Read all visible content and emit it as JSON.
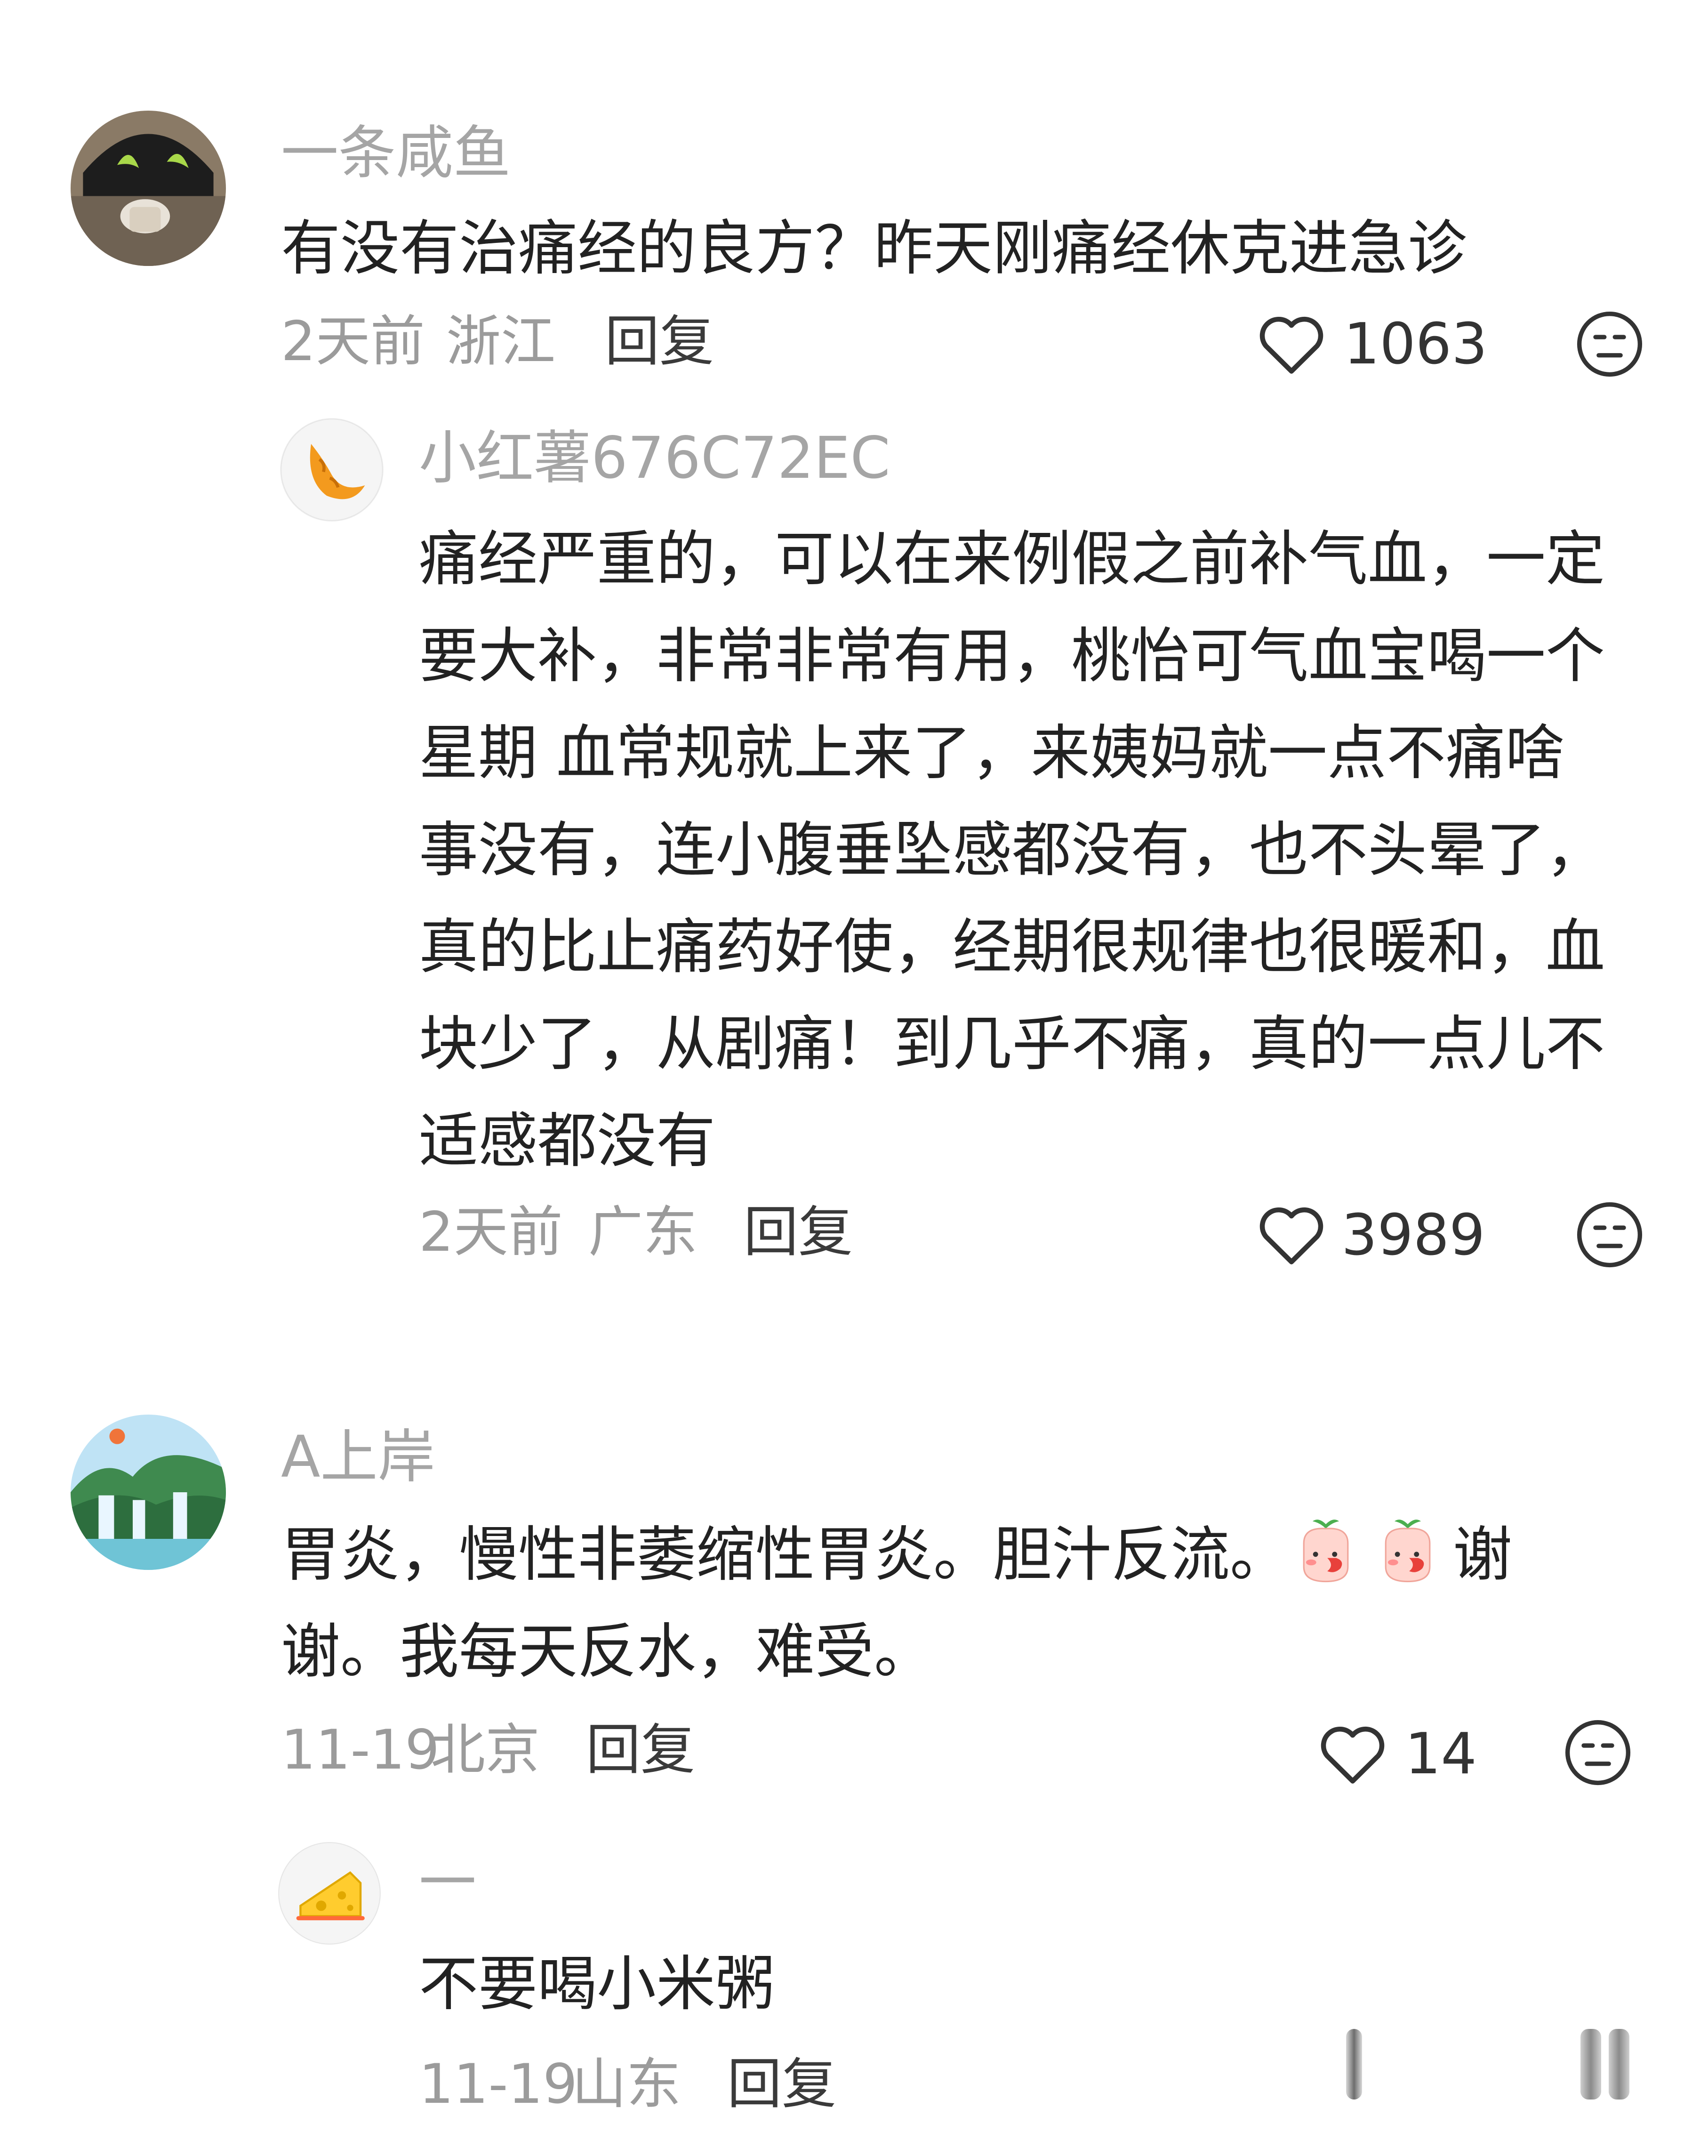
{
  "comments": [
    {
      "username": "一条咸鱼",
      "text": "有没有治痛经的良方？昨天刚痛经休克进急诊",
      "time": "2天前",
      "location": "浙江",
      "reply_label": "回复",
      "likes": "1063",
      "reply": {
        "username": "小红薯676C72EC",
        "text": "痛经严重的，可以在来例假之前补气血，一定要大补，非常非常有用，桃怡可气血宝喝一个星期 血常规就上来了，来姨妈就一点不痛啥事没有，连小腹垂坠感都没有，也不头晕了，真的比止痛药好使，经期很规律也很暖和，血块少了，从剧痛！到几乎不痛，真的一点儿不适感都没有",
        "time": "2天前",
        "location": "广东",
        "reply_label": "回复",
        "likes": "3989"
      }
    },
    {
      "username": "A上岸",
      "text_before_emoji": "胃炎，慢性非萎缩性胃炎。胆汁反流。",
      "text_after_emoji": "谢谢。我每天反水，难受。",
      "inline_emojis": [
        "blushing-peach-emoji",
        "blushing-peach-emoji"
      ],
      "time": "11-19",
      "location": "北京",
      "reply_label": "回复",
      "likes": "14",
      "reply": {
        "username": "一",
        "text": "不要喝小米粥",
        "time": "11-19",
        "location": "山东",
        "reply_label": "回复"
      }
    }
  ],
  "icons": {
    "like": "heart-outline-icon",
    "dislike": "unamused-face-icon"
  },
  "colors": {
    "username": "#a5a5a5",
    "text": "#222222",
    "meta": "#9b9b9b"
  }
}
